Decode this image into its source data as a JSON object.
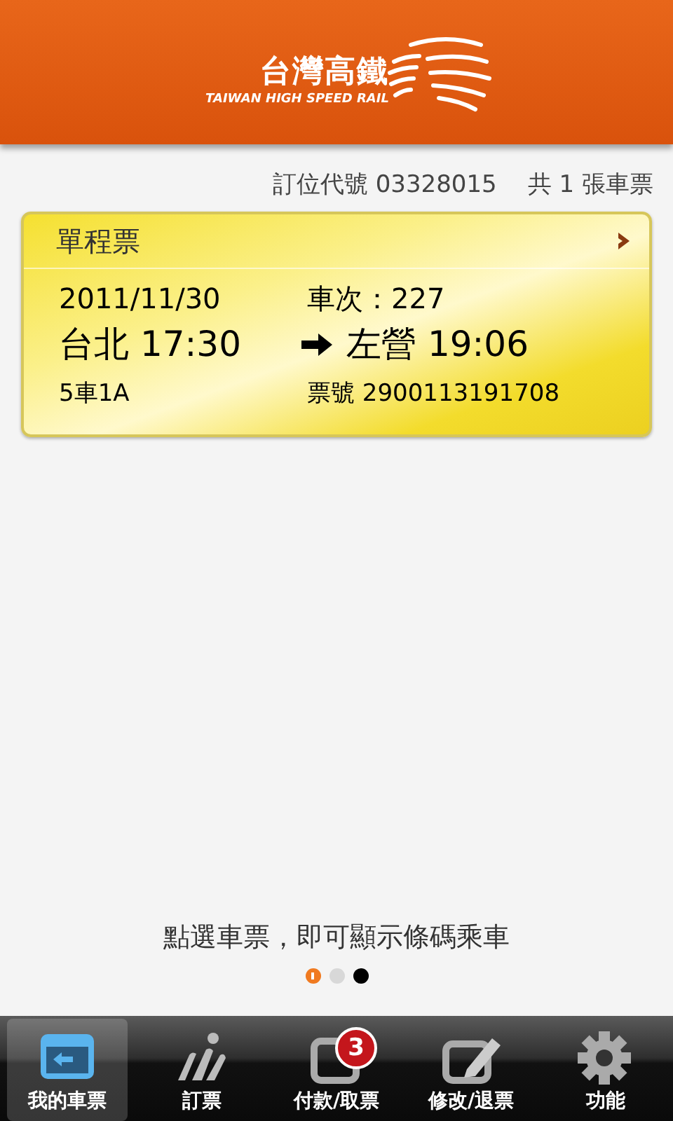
{
  "header": {
    "logo_title": "台灣高鐵",
    "logo_subtitle": "TAIWAN HIGH SPEED RAIL"
  },
  "booking": {
    "code_label": "訂位代號 03328015",
    "count": "共 1 張車票"
  },
  "ticket": {
    "type": "單程票",
    "date": "2011/11/30",
    "train": "車次：227",
    "from": "台北 17:30",
    "to": "左營 19:06",
    "seat": "5車1A",
    "ticket_no": "票號 2900113191708"
  },
  "hint": "點選車票，即可顯示條碼乘車",
  "pager": [
    {
      "selected": true,
      "color": "#f07a20"
    },
    {
      "selected": false,
      "color": "#d8d8d8"
    },
    {
      "selected": false,
      "color": "#000000"
    }
  ],
  "tabs": [
    {
      "kind": "ticket",
      "label": "我的車票",
      "selected": true
    },
    {
      "kind": "seat",
      "label": "訂票",
      "selected": false
    },
    {
      "kind": "pay",
      "label": "付款/取票",
      "selected": false,
      "badge": "3"
    },
    {
      "kind": "edit",
      "label": "修改/退票",
      "selected": false
    },
    {
      "kind": "gear",
      "label": "功能",
      "selected": false
    }
  ]
}
